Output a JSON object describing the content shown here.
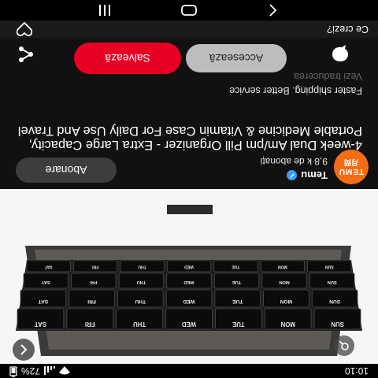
{
  "status_bar": {
    "time": "10:10",
    "battery": "72%"
  },
  "pin": {
    "shop_name": "Temu",
    "avatar_line1": "TEMU",
    "avatar_line2": "月岡",
    "followers": "9,8 k de abonați",
    "follow_label": "Abonare",
    "title": "4-week Dual Am/pm Pill Organizer - Extra Large Capacity, Portable Medicine & Vitamin Case For Daily Use And Travel",
    "subtitle": "Faster shipping. Better service",
    "translate_label": "Vezi traducerea"
  },
  "actions": {
    "access_label": "Accesează",
    "save_label": "Salvează",
    "related_label": "Ce crezi?"
  },
  "organizer": {
    "rows": [
      [
        "SUN",
        "MON",
        "TUE",
        "WED",
        "THU",
        "FRI",
        "SAT"
      ],
      [
        "SUN",
        "MON",
        "TUE",
        "WED",
        "THU",
        "FRI",
        "SAT"
      ],
      [
        "SUN",
        "MON",
        "TUE",
        "WED",
        "THU",
        "FRI",
        "SAT"
      ],
      [
        "SUN",
        "MON",
        "TUE",
        "WED",
        "THU",
        "FRI",
        "SAT"
      ]
    ]
  },
  "icons": {
    "back": "chevron-left-icon",
    "pin_lens": "lens-icon",
    "comment": "comment-icon",
    "share": "share-icon",
    "heart": "heart-icon"
  },
  "colors": {
    "save_button": "#e60023",
    "avatar": "#f46d14",
    "verified": "#3b9bff"
  }
}
